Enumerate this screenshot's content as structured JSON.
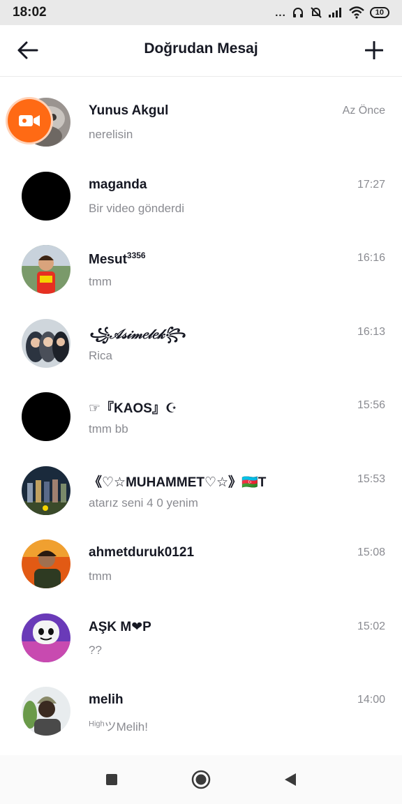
{
  "status_bar": {
    "time": "18:02",
    "dots": "...",
    "battery": "10"
  },
  "header": {
    "title": "Doğrudan Mesaj"
  },
  "conversations": [
    {
      "name": "Yunus Akgul",
      "message": "nerelisin",
      "time": "Az Önce"
    },
    {
      "name": "maganda",
      "message": "Bir video gönderdi",
      "time": "17:27"
    },
    {
      "name": "Mesut",
      "name_sup": "3356",
      "message": "tmm",
      "time": "16:16"
    },
    {
      "name": "꧁𝒜𝓈𝒾𝓂𝑒𝓁𝑒𝓀꧂",
      "message": "Rica",
      "time": "16:13"
    },
    {
      "name": "☞『KAOS』☪",
      "message": "tmm bb",
      "time": "15:56"
    },
    {
      "name": "《♡☆MUHAMMET♡☆》🇦🇿T",
      "message": "atarız seni 4 0 yenim",
      "time": "15:53"
    },
    {
      "name": "ahmetduruk0121",
      "message": "tmm",
      "time": "15:08"
    },
    {
      "name": "AŞK M❤P",
      "message": "??",
      "time": "15:02"
    },
    {
      "name": "melih",
      "message_sup": "High",
      "message": "ツMelih!",
      "time": "14:00"
    }
  ],
  "icons": {
    "back": "arrow-left-icon",
    "add": "plus-icon",
    "live": "video-camera-icon"
  }
}
